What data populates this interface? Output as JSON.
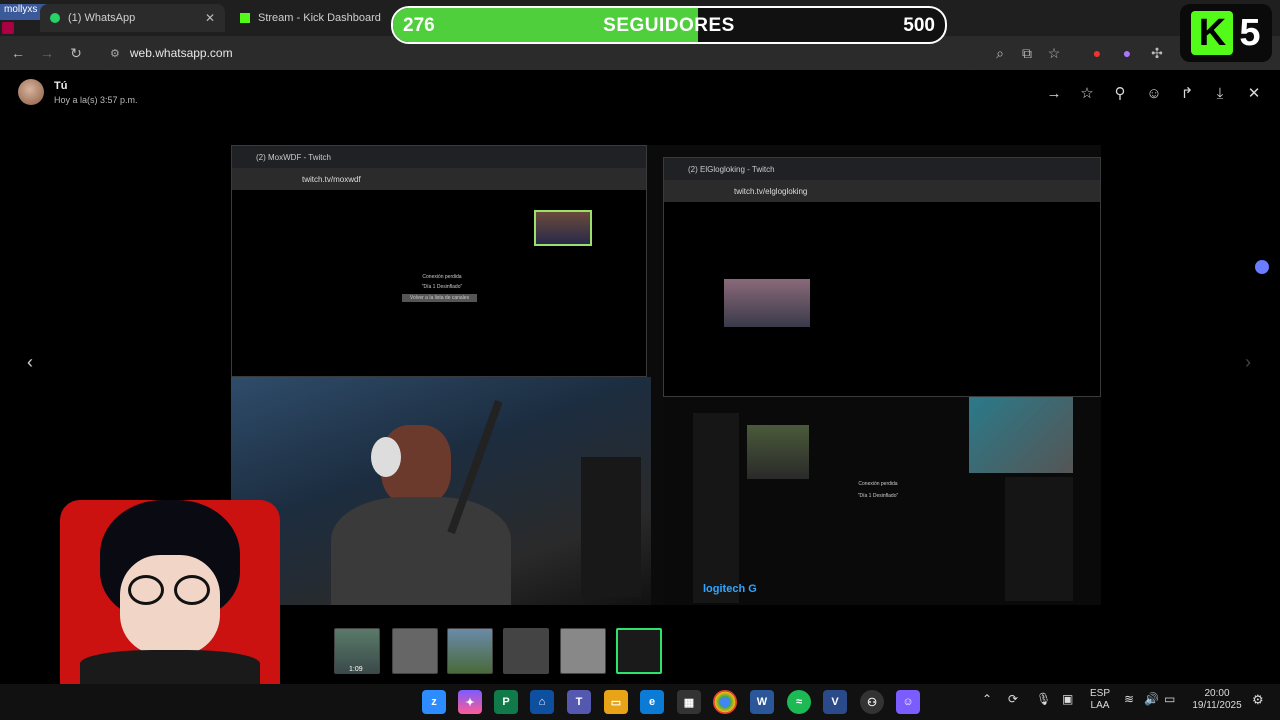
{
  "browser": {
    "profile_label": "mollyxs",
    "tabs": [
      {
        "label": "(1) WhatsApp",
        "active": true
      },
      {
        "label": "Stream - Kick Dashboard",
        "active": false
      }
    ],
    "url": "web.whatsapp.com"
  },
  "followers": {
    "current": "276",
    "label": "SEGUIDORES",
    "goal": "500",
    "progress": 0.552,
    "fill_color": "#4fcf3c"
  },
  "kick_badge": {
    "letter": "K",
    "number": "5",
    "brand_color": "#53fc18"
  },
  "viewer": {
    "sender": "Tú",
    "timestamp": "Hoy a la(s) 3:57 p.m."
  },
  "photo": {
    "left_window": {
      "tab": "(2) MoxWDF - Twitch",
      "url": "twitch.tv/moxwdf",
      "msg1": "Conexión perdida",
      "msg2": "\"Día 1 Desinflado\"",
      "button": "Volver a la lista de canales"
    },
    "right_window": {
      "tab": "(2) ElGlogloking - Twitch",
      "url": "twitch.tv/elglogloking",
      "msg1": "Conexión perdida",
      "msg2": "\"Día 1 Desinflado\"",
      "watermark": "logitech G"
    }
  },
  "thumbnails": [
    {
      "label": "1:09"
    }
  ],
  "taskbar": {
    "language_top": "ESP",
    "language_bottom": "LAA",
    "time": "20:00",
    "date": "19/11/2025",
    "apps": [
      "zoom",
      "copilot",
      "project",
      "vscode",
      "teams",
      "files",
      "edge",
      "store",
      "chrome",
      "word",
      "spotify",
      "vim",
      "game",
      "discord"
    ]
  }
}
